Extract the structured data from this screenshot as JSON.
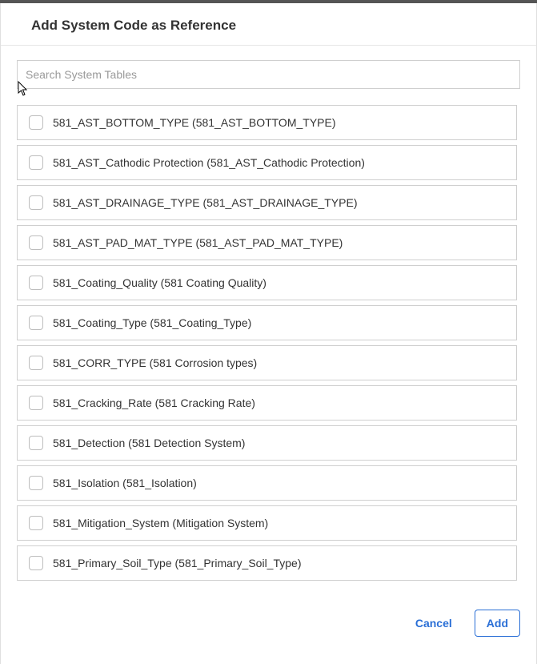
{
  "header": {
    "title": "Add System Code as Reference"
  },
  "search": {
    "placeholder": "Search System Tables",
    "value": ""
  },
  "items": [
    {
      "label": "581_AST_BOTTOM_TYPE (581_AST_BOTTOM_TYPE)"
    },
    {
      "label": "581_AST_Cathodic Protection (581_AST_Cathodic Protection)"
    },
    {
      "label": "581_AST_DRAINAGE_TYPE (581_AST_DRAINAGE_TYPE)"
    },
    {
      "label": "581_AST_PAD_MAT_TYPE (581_AST_PAD_MAT_TYPE)"
    },
    {
      "label": "581_Coating_Quality (581 Coating Quality)"
    },
    {
      "label": "581_Coating_Type (581_Coating_Type)"
    },
    {
      "label": "581_CORR_TYPE (581 Corrosion types)"
    },
    {
      "label": "581_Cracking_Rate (581 Cracking Rate)"
    },
    {
      "label": "581_Detection (581 Detection System)"
    },
    {
      "label": "581_Isolation (581_Isolation)"
    },
    {
      "label": "581_Mitigation_System (Mitigation System)"
    },
    {
      "label": "581_Primary_Soil_Type (581_Primary_Soil_Type)"
    }
  ],
  "footer": {
    "cancel": "Cancel",
    "add": "Add"
  }
}
